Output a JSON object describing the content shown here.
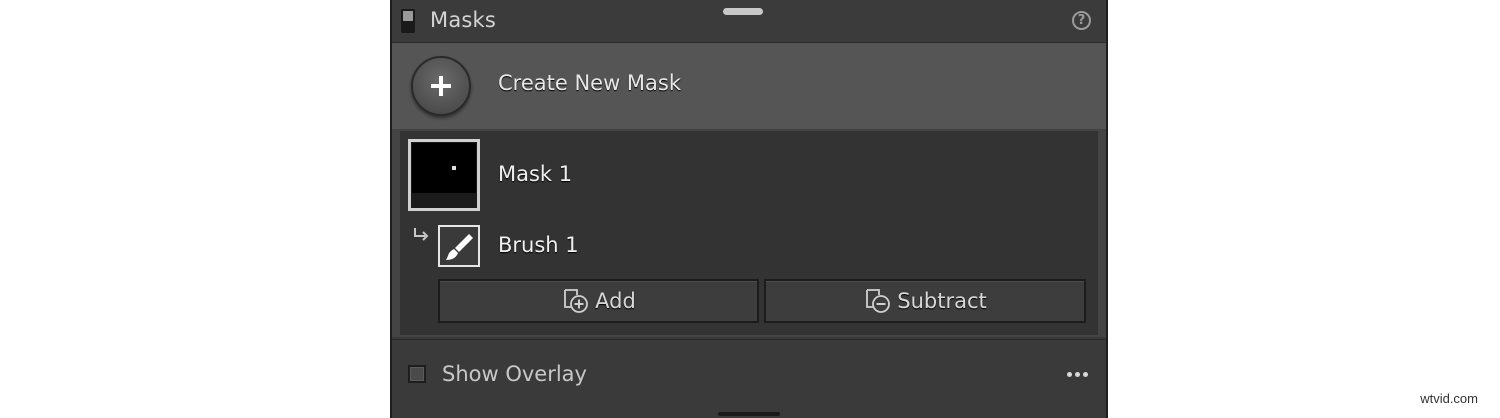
{
  "header": {
    "title": "Masks",
    "help_icon": "?"
  },
  "create": {
    "label": "Create New Mask"
  },
  "masks": [
    {
      "label": "Mask 1",
      "components": [
        {
          "label": "Brush 1",
          "icon": "brush-icon"
        }
      ]
    }
  ],
  "actions": {
    "add_label": "Add",
    "subtract_label": "Subtract"
  },
  "overlay": {
    "label": "Show Overlay",
    "checked": false
  },
  "watermark": "wtvid.com",
  "colors": {
    "panel_bg": "#3a3a3a",
    "create_row_bg": "#555555",
    "mask_box_bg": "#333333"
  }
}
